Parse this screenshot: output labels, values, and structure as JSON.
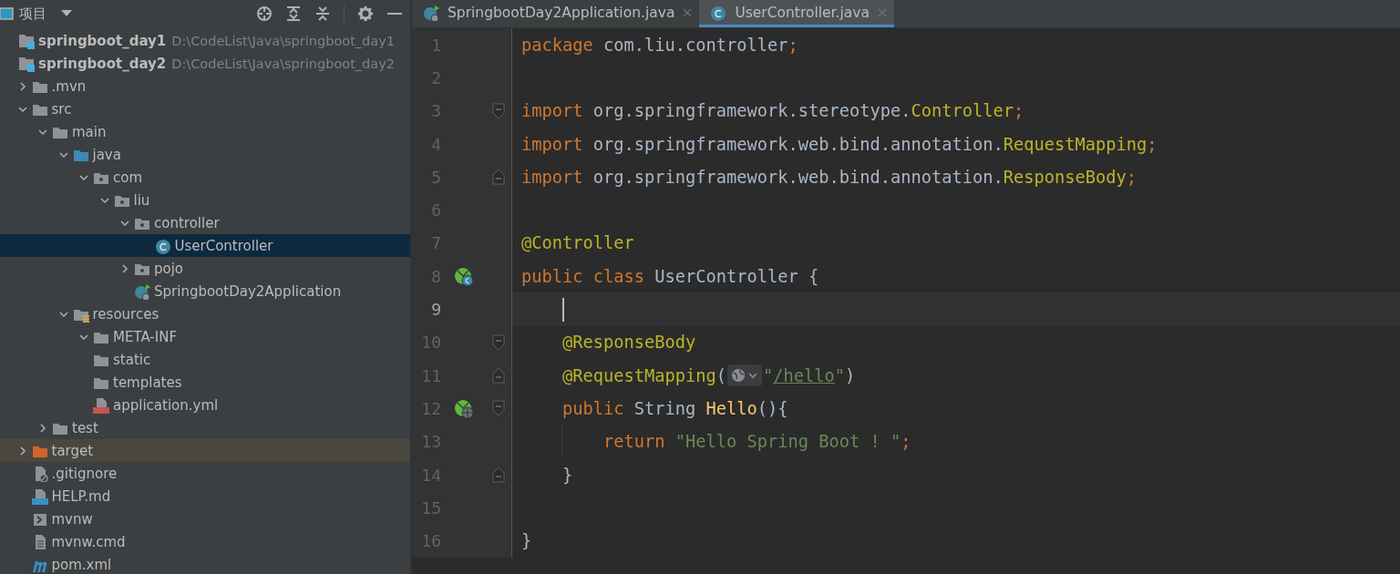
{
  "project_panel": {
    "title": "项目"
  },
  "tree": [
    {
      "label": "springboot_day1",
      "kind": "module",
      "path": "D:\\CodeList\\Java\\springboot_day1",
      "selected": false,
      "excluded": false
    },
    {
      "label": "springboot_day2",
      "kind": "module",
      "path": "D:\\CodeList\\Java\\springboot_day2",
      "selected": false,
      "excluded": false,
      "children": [
        {
          "label": ".mvn",
          "kind": "folder",
          "expanded": false,
          "selected": false,
          "excluded": false
        },
        {
          "label": "src",
          "kind": "folder",
          "expanded": true,
          "selected": false,
          "excluded": false,
          "children": [
            {
              "label": "main",
              "kind": "folder",
              "expanded": true,
              "selected": false,
              "excluded": false,
              "children": [
                {
                  "label": "java",
                  "kind": "source-folder",
                  "expanded": true,
                  "selected": false,
                  "excluded": false,
                  "children": [
                    {
                      "label": "com",
                      "kind": "package",
                      "expanded": true,
                      "selected": false,
                      "excluded": false,
                      "children": [
                        {
                          "label": "liu",
                          "kind": "package",
                          "expanded": true,
                          "selected": false,
                          "excluded": false,
                          "children": [
                            {
                              "label": "controller",
                              "kind": "package",
                              "expanded": true,
                              "selected": false,
                              "excluded": false,
                              "children": [
                                {
                                  "label": "UserController",
                                  "kind": "class",
                                  "selected": true,
                                  "excluded": false
                                }
                              ]
                            },
                            {
                              "label": "pojo",
                              "kind": "package",
                              "expanded": false,
                              "selected": false,
                              "excluded": false
                            },
                            {
                              "label": "SpringbootDay2Application",
                              "kind": "spring-app",
                              "selected": false,
                              "excluded": false
                            }
                          ]
                        }
                      ]
                    }
                  ]
                },
                {
                  "label": "resources",
                  "kind": "resources",
                  "expanded": true,
                  "selected": false,
                  "excluded": false,
                  "children": [
                    {
                      "label": "META-INF",
                      "kind": "folder",
                      "expanded": true,
                      "selected": false,
                      "excluded": false
                    },
                    {
                      "label": "static",
                      "kind": "folder",
                      "selected": false,
                      "excluded": false
                    },
                    {
                      "label": "templates",
                      "kind": "folder",
                      "selected": false,
                      "excluded": false
                    },
                    {
                      "label": "application.yml",
                      "kind": "yml",
                      "selected": false,
                      "excluded": false
                    }
                  ]
                }
              ]
            },
            {
              "label": "test",
              "kind": "folder",
              "expanded": false,
              "selected": false,
              "excluded": false
            }
          ]
        },
        {
          "label": "target",
          "kind": "excluded-folder",
          "expanded": false,
          "selected": false,
          "excluded": true
        },
        {
          "label": ".gitignore",
          "kind": "ignore",
          "selected": false,
          "excluded": false
        },
        {
          "label": "HELP.md",
          "kind": "md",
          "selected": false,
          "excluded": false
        },
        {
          "label": "mvnw",
          "kind": "shell",
          "selected": false,
          "excluded": false
        },
        {
          "label": "mvnw.cmd",
          "kind": "text",
          "selected": false,
          "excluded": false
        },
        {
          "label": "pom.xml",
          "kind": "maven",
          "selected": false,
          "excluded": false
        }
      ]
    }
  ],
  "tabs": [
    {
      "label": "SpringbootDay2Application.java",
      "kind": "spring-app",
      "selected": false
    },
    {
      "label": "UserController.java",
      "kind": "class",
      "selected": true
    }
  ],
  "editor": {
    "lines": [
      {
        "number": "1",
        "current": false,
        "tokens": [
          {
            "text": "package",
            "kind": "keyword"
          },
          {
            "text": " com.liu.controller",
            "kind": "plain"
          },
          {
            "text": ";",
            "kind": "keyword"
          }
        ]
      },
      {
        "number": "2",
        "current": false
      },
      {
        "number": "3",
        "current": false,
        "fold": {
          "kind": "start"
        },
        "tokens": [
          {
            "text": "import",
            "kind": "keyword"
          },
          {
            "text": " org.springframework.stereotype.",
            "kind": "plain"
          },
          {
            "text": "Controller",
            "kind": "annotation"
          },
          {
            "text": ";",
            "kind": "keyword"
          }
        ]
      },
      {
        "number": "4",
        "current": false,
        "tokens": [
          {
            "text": "import",
            "kind": "keyword"
          },
          {
            "text": " org.springframework.web.bind.annotation.",
            "kind": "plain"
          },
          {
            "text": "RequestMapping",
            "kind": "annotation"
          },
          {
            "text": ";",
            "kind": "keyword"
          }
        ]
      },
      {
        "number": "5",
        "current": false,
        "fold": {
          "kind": "end"
        },
        "tokens": [
          {
            "text": "import",
            "kind": "keyword"
          },
          {
            "text": " org.springframework.web.bind.annotation.",
            "kind": "plain"
          },
          {
            "text": "ResponseBody",
            "kind": "annotation"
          },
          {
            "text": ";",
            "kind": "keyword"
          }
        ]
      },
      {
        "number": "6",
        "current": false
      },
      {
        "number": "7",
        "current": false,
        "tokens": [
          {
            "text": "@Controller",
            "kind": "annotation"
          }
        ]
      },
      {
        "number": "8",
        "current": false,
        "gutter_icon": {
          "kind": "bean-class"
        },
        "tokens": [
          {
            "text": "public class",
            "kind": "keyword"
          },
          {
            "text": " UserController {",
            "kind": "plain"
          }
        ]
      },
      {
        "number": "9",
        "current": true,
        "tokens": [
          {
            "kind": "indent"
          },
          {
            "kind": "caret"
          }
        ]
      },
      {
        "number": "10",
        "current": false,
        "fold": {
          "kind": "start"
        },
        "tokens": [
          {
            "kind": "indent"
          },
          {
            "text": "@ResponseBody",
            "kind": "annotation"
          }
        ]
      },
      {
        "number": "11",
        "current": false,
        "fold": {
          "kind": "end"
        },
        "tokens": [
          {
            "kind": "indent"
          },
          {
            "text": "@RequestMapping",
            "kind": "annotation"
          },
          {
            "text": "(",
            "kind": "plain"
          },
          {
            "kind": "inlay"
          },
          {
            "text": "\"",
            "kind": "string"
          },
          {
            "text": "/hello",
            "kind": "link"
          },
          {
            "text": "\"",
            "kind": "string"
          },
          {
            "text": ")",
            "kind": "plain"
          }
        ]
      },
      {
        "number": "12",
        "current": false,
        "fold": {
          "kind": "start"
        },
        "gutter_icon": {
          "kind": "bean-web"
        },
        "tokens": [
          {
            "kind": "indent"
          },
          {
            "text": "public",
            "kind": "keyword"
          },
          {
            "text": " String ",
            "kind": "plain"
          },
          {
            "text": "Hello",
            "kind": "method"
          },
          {
            "text": "(){",
            "kind": "plain"
          }
        ]
      },
      {
        "number": "13",
        "current": false,
        "tokens": [
          {
            "kind": "indent"
          },
          {
            "kind": "guide"
          },
          {
            "kind": "indent"
          },
          {
            "text": "return",
            "kind": "keyword"
          },
          {
            "text": " \"Hello Spring Boot ! \"",
            "kind": "string"
          },
          {
            "text": ";",
            "kind": "keyword"
          }
        ]
      },
      {
        "number": "14",
        "current": false,
        "fold": {
          "kind": "end"
        },
        "tokens": [
          {
            "kind": "indent"
          },
          {
            "text": "}",
            "kind": "plain"
          }
        ]
      },
      {
        "number": "15",
        "current": false
      },
      {
        "number": "16",
        "current": false,
        "tokens": [
          {
            "text": "}",
            "kind": "plain"
          }
        ]
      }
    ]
  }
}
